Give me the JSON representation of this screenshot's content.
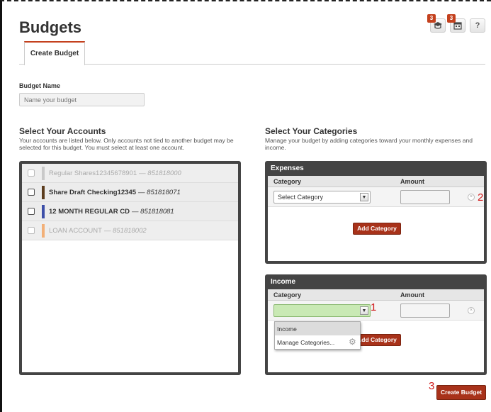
{
  "page": {
    "title": "Budgets"
  },
  "top_icons": [
    {
      "icon": "graduation-cap-icon",
      "badge": "3"
    },
    {
      "icon": "calendar-icon",
      "badge": "3"
    },
    {
      "icon": "help-icon",
      "glyph": "?"
    }
  ],
  "tabs": [
    {
      "label": "Create Budget"
    }
  ],
  "budget_name": {
    "label": "Budget Name",
    "placeholder": "Name your budget"
  },
  "accounts": {
    "title": "Select Your Accounts",
    "description": "Your accounts are listed below. Only accounts not tied to another budget may be selected for this budget. You must select at least one account.",
    "items": [
      {
        "name": "Regular Shares12345678901",
        "number": "— 851818000",
        "color": "#c9c9c9",
        "enabled": false
      },
      {
        "name": "Share Draft Checking12345",
        "number": "— 851818071",
        "color": "#5c3d1e",
        "enabled": true
      },
      {
        "name": "12 MONTH REGULAR CD",
        "number": "— 851818081",
        "color": "#3d4fa8",
        "enabled": true
      },
      {
        "name": "LOAN ACCOUNT",
        "number": "— 851818002",
        "color": "#f2b078",
        "enabled": false
      }
    ]
  },
  "categories": {
    "title": "Select Your Categories",
    "description": "Manage your budget by adding categories toward your monthly expenses and income.",
    "expenses": {
      "header": "Expenses",
      "col_category": "Category",
      "col_amount": "Amount",
      "select_value": "Select Category",
      "add_label": "Add Category"
    },
    "income": {
      "header": "Income",
      "col_category": "Category",
      "col_amount": "Amount",
      "select_value": "",
      "add_label": "Add Category",
      "dropdown_options": [
        "Income",
        "Manage Categories..."
      ]
    }
  },
  "annotations": [
    "1",
    "2",
    "3"
  ],
  "create_button": {
    "label": "Create Budget"
  },
  "colors": {
    "accent": "#a8321a",
    "panel_dark": "#444444",
    "select_green": "#c9e9b4"
  }
}
